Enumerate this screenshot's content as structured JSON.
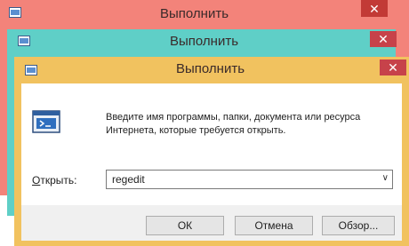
{
  "windows": [
    {
      "title": "Выполнить",
      "color": "#f3837a"
    },
    {
      "title": "Выполнить",
      "color": "#5fcfc7"
    },
    {
      "title": "Выполнить",
      "color": "#f1c25f"
    }
  ],
  "dialog": {
    "description": "Введите имя программы, папки, документа или ресурса Интернета, которые требуется открыть.",
    "open_label_prefix": "О",
    "open_label_rest": "ткрыть:",
    "input_value": "regedit",
    "ok_label": "ОК",
    "cancel_label": "Отмена",
    "browse_label": "Обзор..."
  },
  "icons": {
    "app": "run-dialog-icon",
    "close": "close-icon",
    "big": "run-program-icon",
    "dropdown": "chevron-down-icon"
  }
}
